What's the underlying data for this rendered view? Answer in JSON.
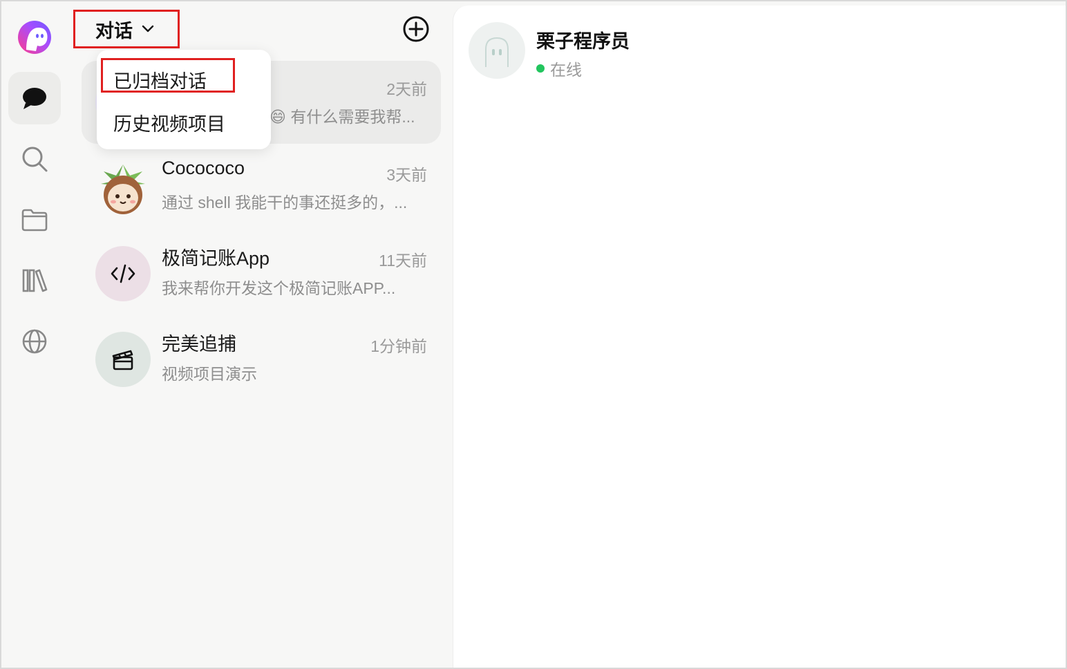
{
  "app": {
    "accent_color": "#e02020",
    "online_color": "#22c55e"
  },
  "rail": {
    "items": [
      {
        "icon": "chat-bubble-icon",
        "active": true
      },
      {
        "icon": "search-icon",
        "active": false
      },
      {
        "icon": "folder-icon",
        "active": false
      },
      {
        "icon": "library-icon",
        "active": false
      },
      {
        "icon": "globe-icon",
        "active": false
      }
    ]
  },
  "header": {
    "title": "对话",
    "new_icon": "add-circle-icon"
  },
  "dropdown": {
    "items": [
      {
        "label": "已归档对话",
        "highlighted": true
      },
      {
        "label": "历史视频项目",
        "highlighted": false
      }
    ]
  },
  "conversations": [
    {
      "name": "",
      "time": "2天前",
      "preview": "😄 有什么需要我帮...",
      "selected": true
    },
    {
      "name": "Cocococo",
      "time": "3天前",
      "preview": "通过 shell 我能干的事还挺多的，..."
    },
    {
      "name": "极简记账App",
      "time": "11天前",
      "preview": "我来帮你开发这个极简记账APP..."
    },
    {
      "name": "完美追捕",
      "time": "1分钟前",
      "preview": "视频项目演示"
    }
  ],
  "chat": {
    "bot_name": "栗子程序员",
    "status": "在线"
  }
}
